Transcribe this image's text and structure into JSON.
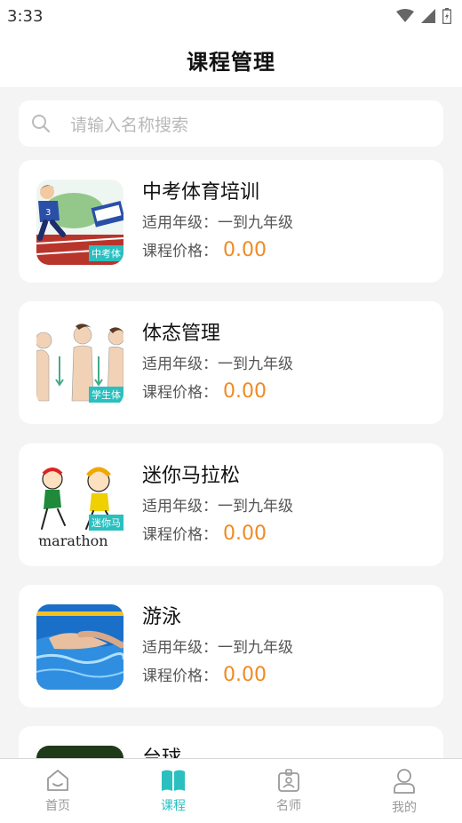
{
  "status_bar": {
    "time": "3:33"
  },
  "header": {
    "title": "课程管理"
  },
  "search": {
    "placeholder": "请输入名称搜索"
  },
  "courses": [
    {
      "name": "中考体育培训",
      "grade": "适用年级：一到九年级",
      "price_label": "课程价格：",
      "price": "0.00",
      "thumb_tag": "中考体",
      "icon": "running-athlete-image"
    },
    {
      "name": "体态管理",
      "grade": "适用年级：一到九年级",
      "price_label": "课程价格：",
      "price": "0.00",
      "thumb_tag": "学生体",
      "icon": "posture-figures-image"
    },
    {
      "name": "迷你马拉松",
      "grade": "适用年级：一到九年级",
      "price_label": "课程价格：",
      "price": "0.00",
      "thumb_tag": "迷你马",
      "thumb_text": "marathon",
      "icon": "marathon-cartoon-image"
    },
    {
      "name": "游泳",
      "grade": "适用年级：一到九年级",
      "price_label": "课程价格：",
      "price": "0.00",
      "icon": "swimmer-image"
    },
    {
      "name": "台球",
      "icon": "billiards-image"
    }
  ],
  "tabs": [
    {
      "label": "首页",
      "icon": "home-icon",
      "active": false
    },
    {
      "label": "课程",
      "icon": "book-icon",
      "active": true
    },
    {
      "label": "名师",
      "icon": "teacher-badge-icon",
      "active": false
    },
    {
      "label": "我的",
      "icon": "person-icon",
      "active": false
    }
  ],
  "colors": {
    "accent": "#2bbfc0",
    "price": "#f08a23",
    "background": "#f4f4f4"
  }
}
